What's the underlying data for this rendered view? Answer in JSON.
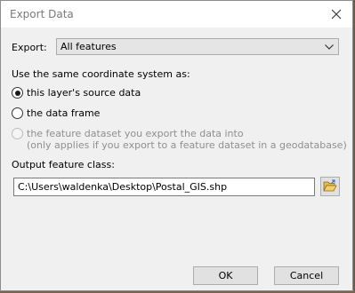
{
  "window": {
    "title": "Export Data"
  },
  "export": {
    "label": "Export:",
    "selected": "All features"
  },
  "coordinate": {
    "heading": "Use the same coordinate system as:",
    "options": [
      {
        "label": "this layer's source data",
        "checked": true,
        "enabled": true
      },
      {
        "label": "the data frame",
        "checked": false,
        "enabled": true
      },
      {
        "label_line1": "the feature dataset you export the data into",
        "label_line2": "(only applies if you export to a feature dataset in a geodatabase)",
        "checked": false,
        "enabled": false
      }
    ]
  },
  "output": {
    "label": "Output feature class:",
    "value": "C:\\Users\\waldenka\\Desktop\\Postal_GIS.shp",
    "browse_icon": "open-folder-icon"
  },
  "buttons": {
    "ok": "OK",
    "cancel": "Cancel"
  }
}
